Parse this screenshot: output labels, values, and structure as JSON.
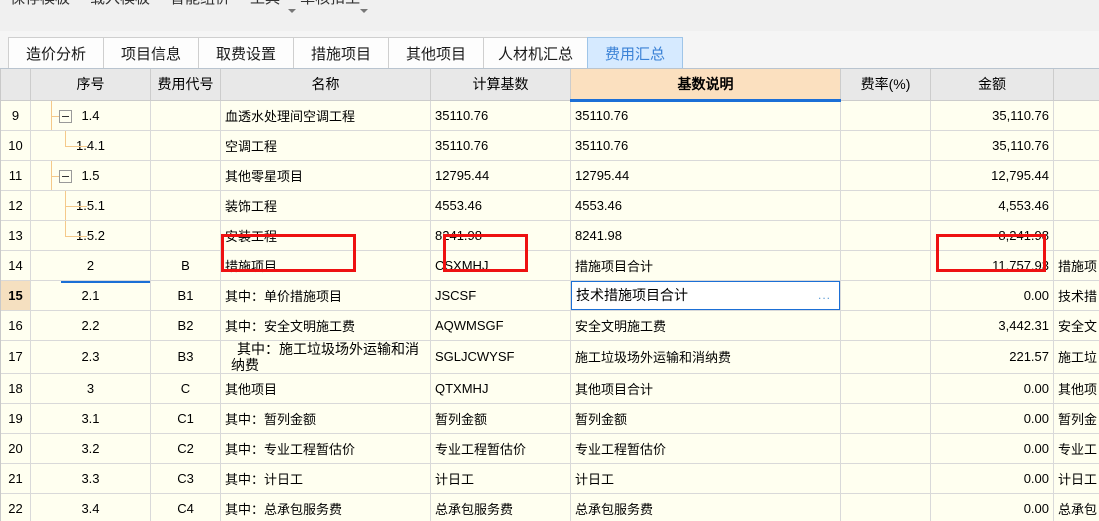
{
  "menubar": {
    "items": [
      {
        "label": "保存模板"
      },
      {
        "label": "载入模板"
      },
      {
        "label": "智能组价"
      },
      {
        "label": "工具"
      },
      {
        "label": "单核扣工"
      }
    ]
  },
  "tabs": [
    {
      "label": "造价分析",
      "active": false
    },
    {
      "label": "项目信息",
      "active": false
    },
    {
      "label": "取费设置",
      "active": false
    },
    {
      "label": "措施项目",
      "active": false
    },
    {
      "label": "其他项目",
      "active": false
    },
    {
      "label": "人材机汇总",
      "active": false
    },
    {
      "label": "费用汇总",
      "active": true
    }
  ],
  "grid": {
    "columns": [
      {
        "key": "rownum",
        "label": ""
      },
      {
        "key": "seq",
        "label": "序号"
      },
      {
        "key": "code",
        "label": "费用代号"
      },
      {
        "key": "name",
        "label": "名称"
      },
      {
        "key": "base",
        "label": "计算基数"
      },
      {
        "key": "desc",
        "label": "基数说明",
        "highlighted": true
      },
      {
        "key": "rate",
        "label": "费率(%)"
      },
      {
        "key": "amount",
        "label": "金额"
      },
      {
        "key": "extra",
        "label": ""
      }
    ],
    "rows": [
      {
        "rownum": "9",
        "seq": "1.4",
        "code": "",
        "name": "血透水处理间空调工程",
        "base": "35110.76",
        "desc": "35110.76",
        "rate": "",
        "amount": "35,110.76",
        "extra": "",
        "indent": 1,
        "toggle": "minus"
      },
      {
        "rownum": "10",
        "seq": "1.4.1",
        "code": "",
        "name": "空调工程",
        "base": "35110.76",
        "desc": "35110.76",
        "rate": "",
        "amount": "35,110.76",
        "extra": "",
        "indent": 2,
        "toggle": "leaf"
      },
      {
        "rownum": "11",
        "seq": "1.5",
        "code": "",
        "name": "其他零星项目",
        "base": "12795.44",
        "desc": "12795.44",
        "rate": "",
        "amount": "12,795.44",
        "extra": "",
        "indent": 1,
        "toggle": "minus"
      },
      {
        "rownum": "12",
        "seq": "1.5.1",
        "code": "",
        "name": "装饰工程",
        "base": "4553.46",
        "desc": "4553.46",
        "rate": "",
        "amount": "4,553.46",
        "extra": "",
        "indent": 2,
        "toggle": "leaf"
      },
      {
        "rownum": "13",
        "seq": "1.5.2",
        "code": "",
        "name": "安装工程",
        "base": "8241.98",
        "desc": "8241.98",
        "rate": "",
        "amount": "8,241.98",
        "extra": "",
        "indent": 2,
        "toggle": "leaf"
      },
      {
        "rownum": "14",
        "seq": "2",
        "code": "B",
        "name": "措施项目",
        "base": "CSXMHJ",
        "desc": "措施项目合计",
        "rate": "",
        "amount": "11,757.93",
        "extra": "措施项",
        "indent": 0,
        "toggle": "none"
      },
      {
        "rownum": "15",
        "seq": "2.1",
        "code": "B1",
        "name": "其中：单价措施项目",
        "base": "JSCSF",
        "desc": "技术措施项目合计",
        "rate": "",
        "amount": "0.00",
        "extra": "技术措",
        "indent": 0,
        "toggle": "none",
        "selected": true,
        "editing": true,
        "ellipsis": "..."
      },
      {
        "rownum": "16",
        "seq": "2.2",
        "code": "B2",
        "name": "其中：安全文明施工费",
        "base": "AQWMSGF",
        "desc": "安全文明施工费",
        "rate": "",
        "amount": "3,442.31",
        "extra": "安全文",
        "indent": 0,
        "toggle": "none"
      },
      {
        "rownum": "17",
        "seq": "2.3",
        "code": "B3",
        "name": "其中：施工垃圾场外运输和消纳费",
        "base": "SGLJCWYSF",
        "desc": "施工垃圾场外运输和消纳费",
        "rate": "",
        "amount": "221.57",
        "extra": "施工垃",
        "indent": 0,
        "toggle": "none",
        "wrap": true
      },
      {
        "rownum": "18",
        "seq": "3",
        "code": "C",
        "name": "其他项目",
        "base": "QTXMHJ",
        "desc": "其他项目合计",
        "rate": "",
        "amount": "0.00",
        "extra": "其他项",
        "indent": 0,
        "toggle": "none"
      },
      {
        "rownum": "19",
        "seq": "3.1",
        "code": "C1",
        "name": "其中：暂列金额",
        "base": "暂列金额",
        "desc": "暂列金额",
        "rate": "",
        "amount": "0.00",
        "extra": "暂列金",
        "indent": 0,
        "toggle": "none"
      },
      {
        "rownum": "20",
        "seq": "3.2",
        "code": "C2",
        "name": "其中：专业工程暂估价",
        "base": "专业工程暂估价",
        "desc": "专业工程暂估价",
        "rate": "",
        "amount": "0.00",
        "extra": "专业工",
        "indent": 0,
        "toggle": "none"
      },
      {
        "rownum": "21",
        "seq": "3.3",
        "code": "C3",
        "name": "其中：计日工",
        "base": "计日工",
        "desc": "计日工",
        "rate": "",
        "amount": "0.00",
        "extra": "计日工",
        "indent": 0,
        "toggle": "none"
      },
      {
        "rownum": "22",
        "seq": "3.4",
        "code": "C4",
        "name": "其中：总承包服务费",
        "base": "总承包服务费",
        "desc": "总承包服务费",
        "rate": "",
        "amount": "0.00",
        "extra": "总承包",
        "indent": 0,
        "toggle": "none"
      }
    ]
  },
  "annotations": [
    {
      "id": "annot-name",
      "target": "row-14-name-cell"
    },
    {
      "id": "annot-base",
      "target": "row-14-base-cell"
    },
    {
      "id": "annot-amount",
      "target": "row-14-amount-cell"
    }
  ],
  "colors": {
    "accent": "#1b6fd6",
    "header_highlight": "#fbe0bf",
    "selection": "#bcd9f5",
    "annotation": "#ee1111",
    "row_background": "#fffff0",
    "tree_line": "#f5c98a"
  }
}
